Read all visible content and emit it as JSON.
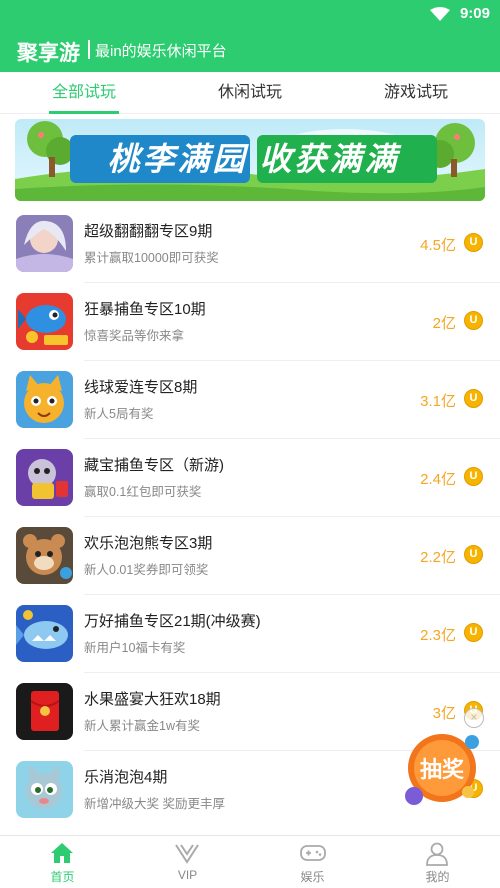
{
  "statusbar": {
    "time": "9:09"
  },
  "header": {
    "title": "聚享游",
    "slogan": "最in的娱乐休闲平台"
  },
  "tabs": [
    {
      "label": "全部试玩",
      "active": true
    },
    {
      "label": "休闲试玩",
      "active": false
    },
    {
      "label": "游戏试玩",
      "active": false
    }
  ],
  "banner": {
    "text": "桃李满园 收获满满"
  },
  "games": [
    {
      "name": "超级翻翻翻专区9期",
      "desc": "累计赢取10000即可获奖",
      "amount": "4.5亿",
      "icon": "fantasy-warrior-icon"
    },
    {
      "name": "狂暴捕鱼专区10期",
      "desc": "惊喜奖品等你来拿",
      "amount": "2亿",
      "icon": "fish-game-icon"
    },
    {
      "name": "线球爱连专区8期",
      "desc": "新人5局有奖",
      "amount": "3.1亿",
      "icon": "cat-game-icon"
    },
    {
      "name": "藏宝捕鱼专区（新游)",
      "desc": "赢取0.1红包即可获奖",
      "amount": "2.4亿",
      "icon": "treasure-fish-icon"
    },
    {
      "name": "欢乐泡泡熊专区3期",
      "desc": "新人0.01奖券即可领奖",
      "amount": "2.2亿",
      "icon": "bubble-bear-icon"
    },
    {
      "name": "万好捕鱼专区21期(冲级赛)",
      "desc": "新用户10福卡有奖",
      "amount": "2.3亿",
      "icon": "shark-fish-icon"
    },
    {
      "name": "水果盛宴大狂欢18期",
      "desc": "新人累计赢金1w有奖",
      "amount": "3亿",
      "icon": "red-envelope-icon"
    },
    {
      "name": "乐消泡泡4期",
      "desc": "新增冲级大奖 奖励更丰厚",
      "amount": "",
      "icon": "bubble-cat-icon"
    }
  ],
  "coin_symbol": "U",
  "lottery": {
    "label": "抽奖",
    "close": "×"
  },
  "nav": [
    {
      "label": "首页",
      "icon": "home-icon",
      "active": true
    },
    {
      "label": "VIP",
      "icon": "vip-icon",
      "active": false
    },
    {
      "label": "娱乐",
      "icon": "gamepad-icon",
      "active": false
    },
    {
      "label": "我的",
      "icon": "user-icon",
      "active": false
    }
  ],
  "colors": {
    "primary": "#2ecc71",
    "amount": "#f5a623",
    "coin": "#f6b400"
  }
}
